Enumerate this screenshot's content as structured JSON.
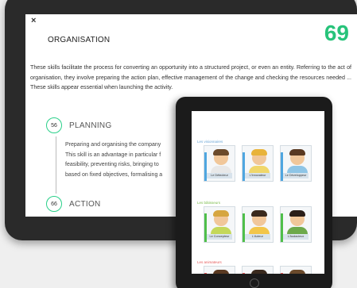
{
  "detail": {
    "close_label": "×",
    "title": "ORGANISATION",
    "score": "69",
    "paragraph": "These skills facilitate the process for converting an opportunity into a structured project, or even an entity. Referring to the act of organisation, they involve preparing the action plan, effective management of the change and checking the resources needed ... These skills appear essential when launching the activity.",
    "skills": [
      {
        "score": "56",
        "label": "PLANNING",
        "lines": [
          "Preparing and organising the company",
          "This skill is an advantage in particular f",
          "feasibility, preventing risks, bringing to",
          "based on fixed objectives, formalising a"
        ]
      },
      {
        "score": "66",
        "label": "ACTION"
      }
    ]
  },
  "profiles_app": {
    "sections": [
      {
        "label": "Les visionnaires",
        "color": "#6aa6d6",
        "cards": [
          {
            "name": "Le Détecteur",
            "bar_color": "#4fa6e0",
            "shirt": "#e8e8e8",
            "hair": "#6b4a2b"
          },
          {
            "name": "L'Innovateur",
            "bar_color": "#4fa6e0",
            "shirt": "#f0d76a",
            "hair": "#e8b33a"
          },
          {
            "name": "Le Développeur",
            "bar_color": "#4fa6e0",
            "shirt": "#8fc5e6",
            "hair": "#5a3a22"
          }
        ]
      },
      {
        "label": "Les bâtisseurs",
        "color": "#79bb48",
        "cards": [
          {
            "name": "Le Concepteur",
            "bar_color": "#4fbf4a",
            "shirt": "#c4d85a",
            "hair": "#d6a640"
          },
          {
            "name": "L'Acteur",
            "bar_color": "#4fbf4a",
            "shirt": "#f2c64a",
            "hair": "#3a2a1e"
          },
          {
            "name": "L'Audacieux",
            "bar_color": "#4fbf4a",
            "shirt": "#6da94b",
            "hair": "#2a1e18"
          }
        ]
      },
      {
        "label": "Les animateurs",
        "color": "#e55b5b",
        "cards": [
          {
            "name": "",
            "bar_color": "#e55b5b",
            "shirt": "#8fc5e6",
            "hair": "#5a3a22"
          },
          {
            "name": "",
            "bar_color": "#e55b5b",
            "shirt": "#f0d76a",
            "hair": "#3a2a1e"
          },
          {
            "name": "",
            "bar_color": "#e55b5b",
            "shirt": "#c4d85a",
            "hair": "#6b4a2b"
          }
        ]
      }
    ]
  }
}
